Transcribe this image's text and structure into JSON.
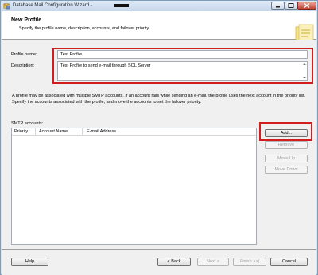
{
  "window": {
    "title": "Database Mail Configuration Wizard -",
    "minimize_label": "",
    "maximize_label": "",
    "close_label": ""
  },
  "header": {
    "title": "New Profile",
    "subtitle": "Specify the profile name, description, accounts, and failover priority."
  },
  "form": {
    "profile_name_label": "Profile name:",
    "profile_name_value": "Test Profile",
    "description_label": "Description:",
    "description_value": "Test Profile to send e-mail through SQL Server"
  },
  "info_text": "A profile may be associated with multiple SMTP accounts. If an account fails while sending an e-mail, the profile uses the next account in the priority list. Specify the accounts associated with the profile, and move the accounts to set the failover priority.",
  "smtp": {
    "label": "SMTP accounts:",
    "columns": [
      "Priority",
      "Account Name",
      "E-mail Address"
    ],
    "rows": []
  },
  "side_buttons": {
    "add": "Add...",
    "remove": "Remove",
    "move_up": "Move Up",
    "move_down": "Move Down"
  },
  "footer": {
    "help": "Help",
    "back": "< Back",
    "next": "Next >",
    "finish": "Finish >>|",
    "cancel": "Cancel"
  },
  "colors": {
    "highlight": "#d11d1d",
    "title_bg": "#dfe9f5"
  }
}
